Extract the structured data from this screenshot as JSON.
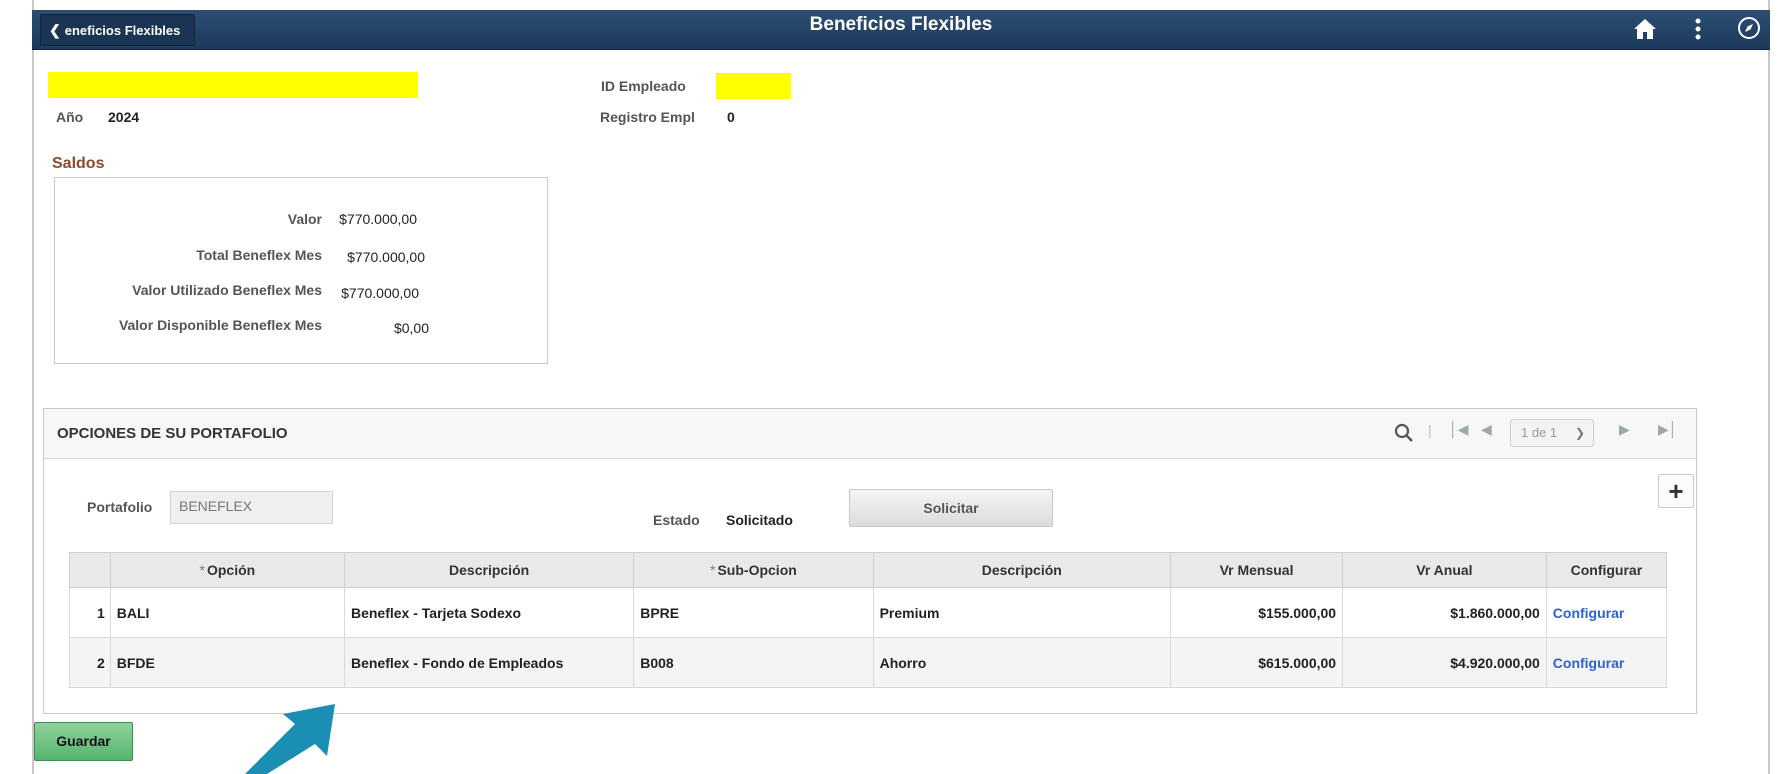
{
  "header": {
    "back_label": "eneficios Flexibles",
    "title": "Beneficios Flexibles",
    "icons": [
      "home-icon",
      "kebab-menu-icon",
      "navbar-icon"
    ]
  },
  "info": {
    "anio_label": "Año",
    "anio_value": "2024",
    "id_empleado_label": "ID Empleado",
    "registro_label": "Registro Empl",
    "registro_value": "0"
  },
  "saldos": {
    "title": "Saldos",
    "rows": [
      {
        "label": "Valor",
        "value": "$770.000,00"
      },
      {
        "label": "Total Beneflex Mes",
        "value": "$770.000,00"
      },
      {
        "label": "Valor Utilizado Beneflex Mes",
        "value": "$770.000,00"
      },
      {
        "label": "Valor Disponible Beneflex Mes",
        "value": "$0,00"
      }
    ]
  },
  "portfolio": {
    "title": "OPCIONES DE SU PORTAFOLIO",
    "pager_value": "1 de 1",
    "portafolio_label": "Portafolio",
    "portafolio_value": "BENEFLEX",
    "estado_label": "Estado",
    "estado_value": "Solicitado",
    "solicitar_label": "Solicitar",
    "columns": [
      "",
      "Opción",
      "Descripción",
      "Sub-Opcion",
      "Descripción",
      "Vr Mensual",
      "Vr Anual",
      "Configurar"
    ],
    "rows": [
      {
        "n": "1",
        "opcion": "BALI",
        "desc": "Beneflex - Tarjeta Sodexo",
        "sub": "BPRE",
        "sub_desc": "Premium",
        "mensual": "$155.000,00",
        "anual": "$1.860.000,00",
        "config": "Configurar"
      },
      {
        "n": "2",
        "opcion": "BFDE",
        "desc": "Beneflex - Fondo de Empleados",
        "sub": "B008",
        "sub_desc": "Ahorro",
        "mensual": "$615.000,00",
        "anual": "$4.920.000,00",
        "config": "Configurar"
      }
    ]
  },
  "footer": {
    "guardar_label": "Guardar"
  },
  "colors": {
    "header": "#1d3a5c",
    "section_title": "#8a4b2a",
    "link": "#2f63c5",
    "guardar": "#55b46d",
    "highlight": "#ffff00",
    "arrow": "#1a8fb3"
  }
}
